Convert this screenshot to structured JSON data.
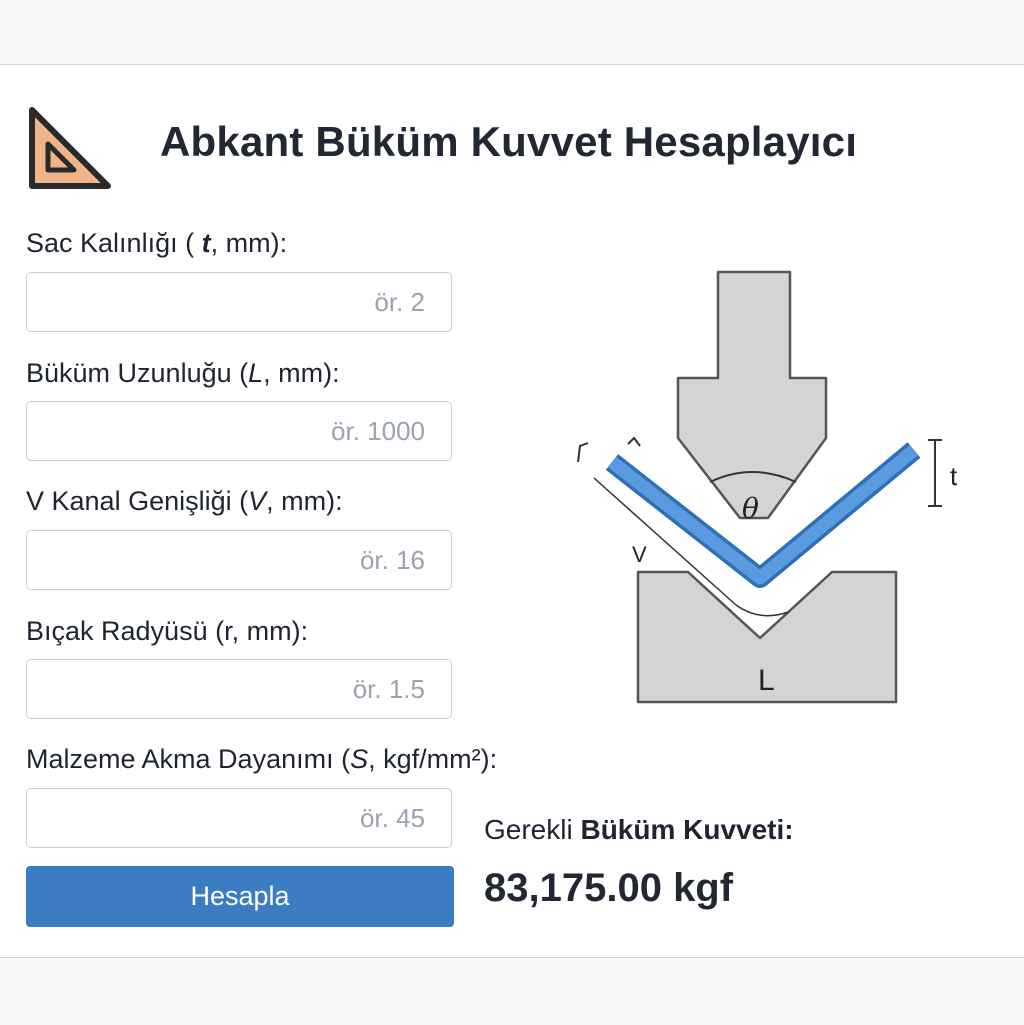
{
  "app": {
    "title": "Abkant Büküm Kuvvet Hesaplayıcı"
  },
  "fields": [
    {
      "label_pre": "Sac Kalınlığı ( ",
      "label_var": "t",
      "label_post": ", mm):",
      "value": "",
      "placeholder": "ör. 2"
    },
    {
      "label_pre": "Büküm Uzunluğu (",
      "label_var": "L",
      "label_post": ", mm):",
      "value": "",
      "placeholder": "ör. 1000"
    },
    {
      "label_pre": "V Kanal Genişliği (",
      "label_var": "V",
      "label_post": ", mm):",
      "value": "",
      "placeholder": "ör. 16"
    },
    {
      "label_pre": "Bıçak Radyüsü (",
      "label_var": "r",
      "label_post": ", mm):",
      "value": "",
      "placeholder": "ör. 1.5"
    },
    {
      "label_pre": "Malzeme Akma Dayanımı (",
      "label_var": "S",
      "label_post": ", kgf/mm²):",
      "value": "",
      "placeholder": "ör. 45"
    }
  ],
  "button": {
    "label": "Hesapla"
  },
  "result": {
    "label_pre": "Gerekli ",
    "label_bold": "Büküm Kuvveti:",
    "value": "83,175.00 kgf"
  },
  "diagram": {
    "theta": "θ",
    "t": "t",
    "v": "V",
    "l": "L"
  },
  "colors": {
    "accent": "#3b7cc3",
    "sheet": "#4a8fd6",
    "tool": "#d4d4d4",
    "logo": "#f0b48a"
  },
  "icons": {
    "logo": "triangle-ruler-icon"
  }
}
